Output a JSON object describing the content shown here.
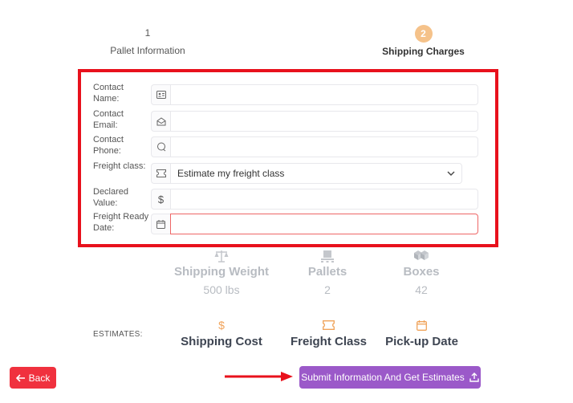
{
  "steps": [
    {
      "number": "1",
      "label": "Pallet Information"
    },
    {
      "number": "2",
      "label": "Shipping Charges"
    }
  ],
  "form": {
    "contact_name": {
      "label": "Contact Name:",
      "value": ""
    },
    "contact_email": {
      "label": "Contact Email:",
      "value": ""
    },
    "contact_phone": {
      "label": "Contact Phone:",
      "value": ""
    },
    "freight_class": {
      "label": "Freight class:",
      "selected": "Estimate my freight class"
    },
    "declared_value": {
      "label": "Declared Value:",
      "value": ""
    },
    "ready_date": {
      "label": "Freight Ready Date:",
      "value": ""
    }
  },
  "summary": {
    "weight": {
      "title": "Shipping Weight",
      "value": "500 lbs"
    },
    "pallets": {
      "title": "Pallets",
      "value": "2"
    },
    "boxes": {
      "title": "Boxes",
      "value": "42"
    }
  },
  "estimates": {
    "label": "ESTIMATES:",
    "cost": {
      "title": "Shipping Cost"
    },
    "freight_class": {
      "title": "Freight Class"
    },
    "pickup": {
      "title": "Pick-up Date"
    }
  },
  "buttons": {
    "back": "Back",
    "submit": "Submit Information And Get Estimates"
  },
  "colors": {
    "accent_orange": "#f5c28a",
    "highlight_red": "#e8111c",
    "back_red": "#f0313e",
    "submit_purple": "#9b59c9"
  }
}
